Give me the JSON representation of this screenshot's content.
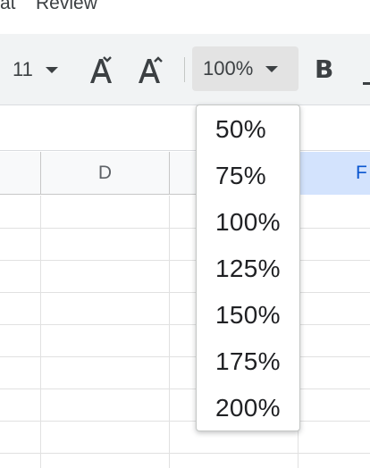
{
  "menubar": {
    "items": [
      "at",
      "Review"
    ]
  },
  "toolbar": {
    "font_size": "11",
    "zoom_value": "100%",
    "bold_label": "B",
    "icons": [
      "caret-down-icon",
      "increase-font-size-icon",
      "decrease-font-size-icon",
      "bold-icon"
    ]
  },
  "columns": [
    "",
    "D",
    "",
    "F"
  ],
  "zoom_menu": {
    "options": [
      "50%",
      "75%",
      "100%",
      "125%",
      "150%",
      "175%",
      "200%"
    ]
  },
  "colors": {
    "selected_column_bg": "#d3e3fd",
    "selected_column_text": "#0b57d0",
    "toolbar_bg": "#f1f3f4"
  }
}
